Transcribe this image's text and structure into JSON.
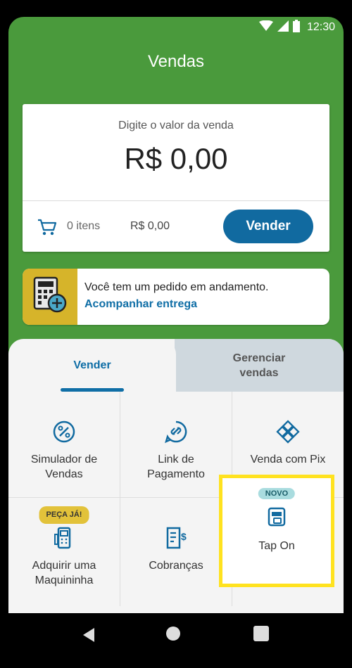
{
  "status_bar": {
    "time": "12:30"
  },
  "header": {
    "title": "Vendas"
  },
  "sale_card": {
    "prompt": "Digite o valor da venda",
    "amount": "R$ 0,00",
    "cart_count": "0 itens",
    "cart_total": "R$ 0,00",
    "sell_button": "Vender"
  },
  "order_banner": {
    "message": "Você tem um pedido em andamento.",
    "link": "Acompanhar entrega"
  },
  "tabs": [
    {
      "label": "Vender",
      "active": true
    },
    {
      "label": "Gerenciar vendas",
      "active": false
    }
  ],
  "actions": [
    {
      "label": "Simulador de Vendas",
      "icon": "percent-icon"
    },
    {
      "label": "Link de Pagamento",
      "icon": "payment-link-icon"
    },
    {
      "label": "Venda com Pix",
      "icon": "pix-icon"
    },
    {
      "label": "Adquirir uma Maquininha",
      "icon": "card-machine-icon",
      "badge": "PEÇA JÁ!"
    },
    {
      "label": "Cobranças",
      "icon": "invoice-icon"
    },
    {
      "label": "Tap On",
      "icon": "tap-on-icon",
      "badge": "NOVO",
      "highlighted": true
    }
  ],
  "colors": {
    "app_green": "#4a9a3c",
    "primary_blue": "#116aa0",
    "highlight_yellow": "#ffe21f",
    "banner_yellow": "#d6b42a"
  }
}
